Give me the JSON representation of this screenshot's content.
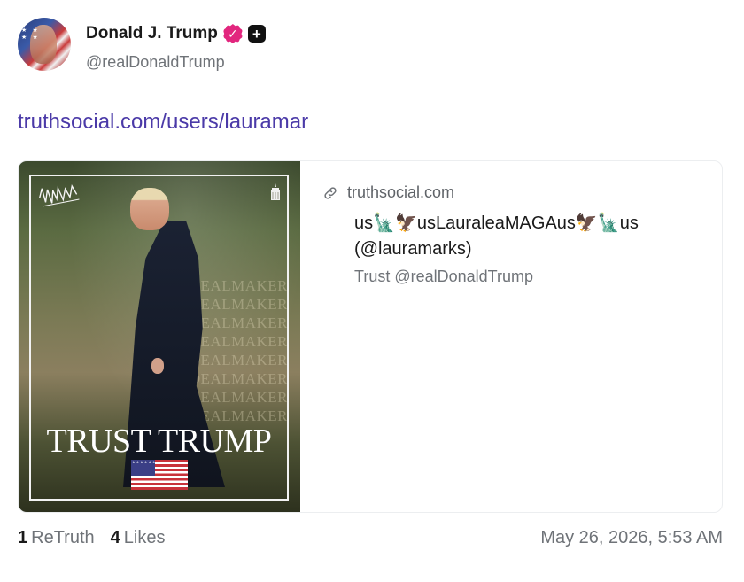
{
  "author": {
    "display_name": "Donald J. Trump",
    "handle": "@realDonaldTrump",
    "verified_icon": "verified-badge-icon",
    "subscription_icon": "plus-square-icon"
  },
  "post": {
    "link_text": "truthsocial.com/users/lauramar"
  },
  "link_card": {
    "domain": "truthsocial.com",
    "title": "us🗽🦅usLauraleaMAGAus🦅🗽us (@lauramarks)",
    "description": "Trust @realDonaldTrump",
    "image": {
      "headline": "TRUST TRUMP",
      "background_text": "DEALMAKER DEALMAKER DEALMAKER DEALMAKER DEALMAKER DEALMAKER DEALMAKER DEALMAKER"
    }
  },
  "stats": {
    "retruth_count": "1",
    "retruth_label": "ReTruth",
    "likes_count": "4",
    "likes_label": "Likes"
  },
  "timestamp": "May 26, 2026, 5:53 AM",
  "colors": {
    "link": "#4b3aa8",
    "verified": "#e2267e",
    "muted": "#6f7378"
  }
}
